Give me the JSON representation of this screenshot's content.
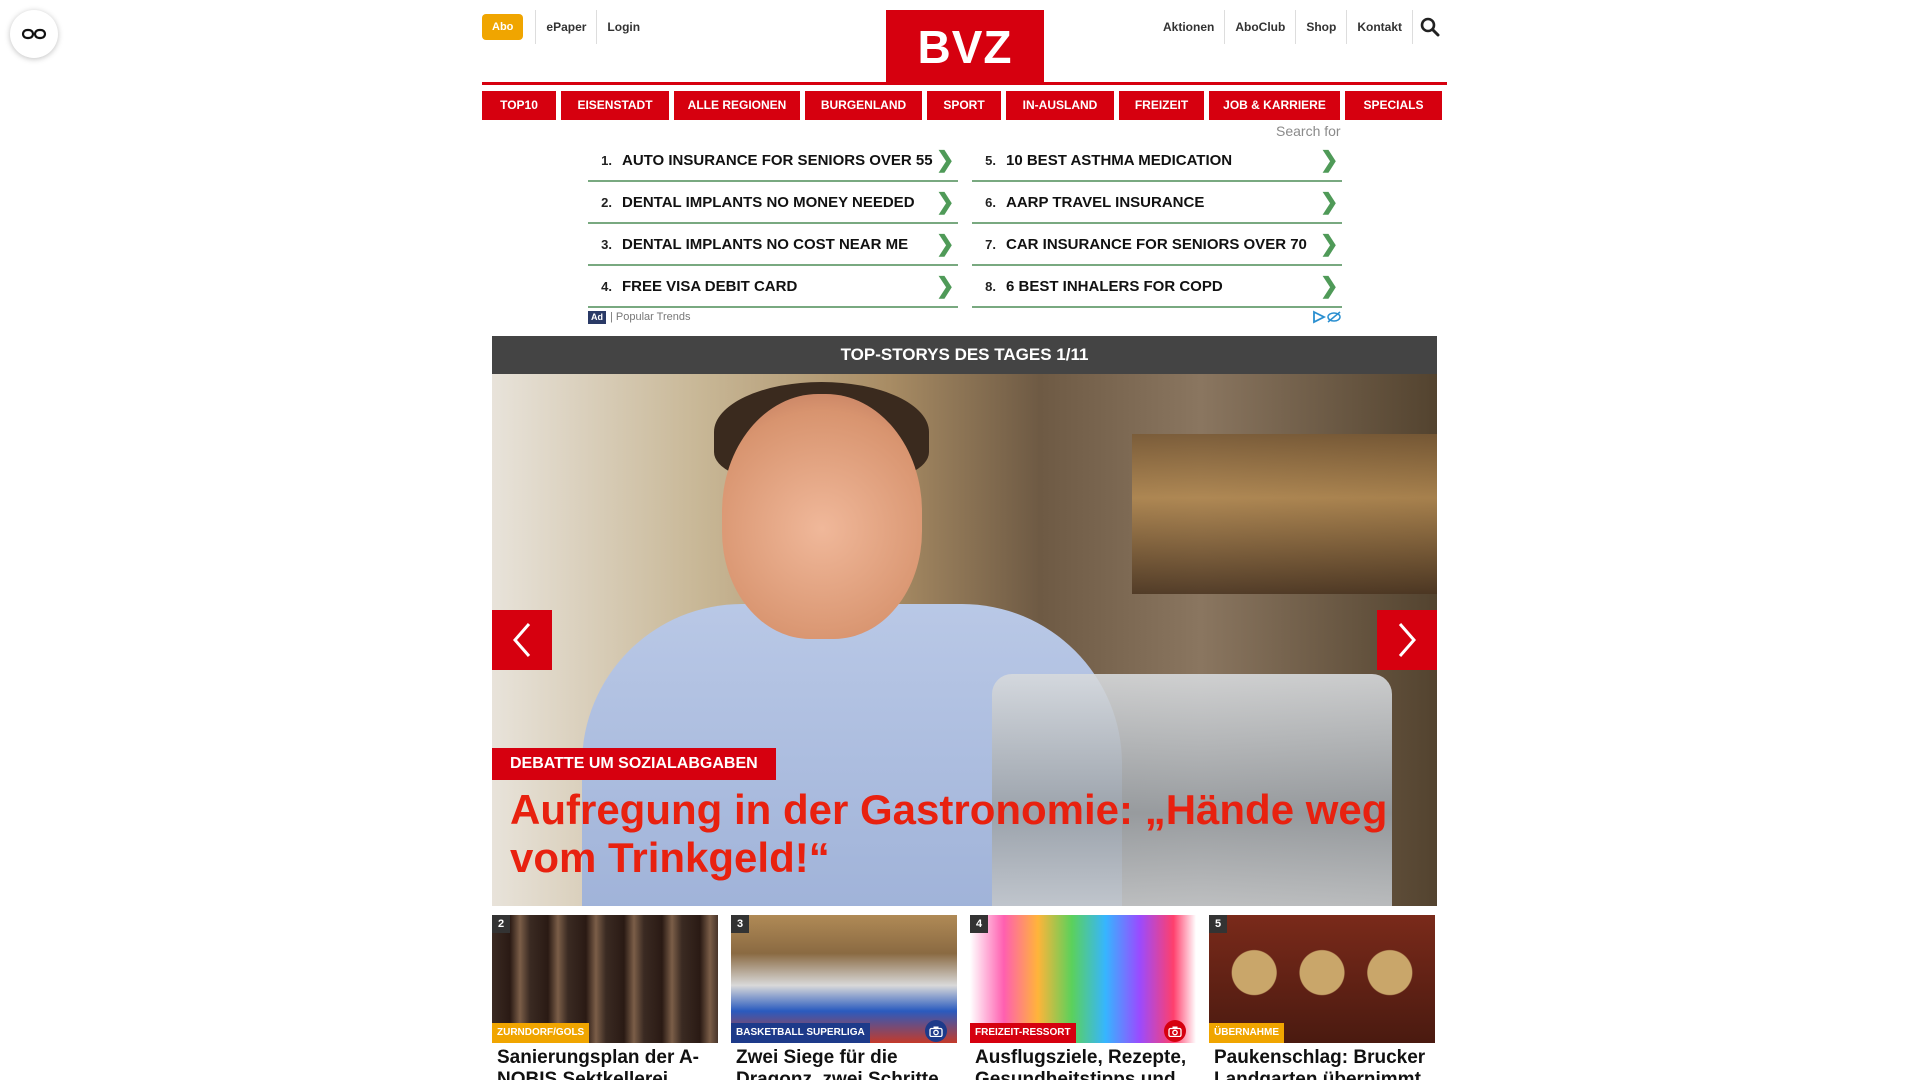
{
  "header": {
    "abo": "Abo",
    "left_links": [
      "ePaper",
      "Login"
    ],
    "logo": "BVZ",
    "right_links": [
      "Aktionen",
      "AboClub",
      "Shop",
      "Kontakt"
    ]
  },
  "nav": {
    "items": [
      "TOP10",
      "EISENSTADT",
      "ALLE REGIONEN",
      "BURGENLAND",
      "SPORT",
      "IN-AUSLAND",
      "FREIZEIT",
      "JOB & KARRIERE",
      "SPECIALS"
    ]
  },
  "ad": {
    "search_for": "Search for",
    "left": [
      {
        "num": "1.",
        "label": "AUTO INSURANCE FOR SENIORS OVER 55"
      },
      {
        "num": "2.",
        "label": "DENTAL IMPLANTS NO MONEY NEEDED"
      },
      {
        "num": "3.",
        "label": "DENTAL IMPLANTS NO COST NEAR ME"
      },
      {
        "num": "4.",
        "label": "FREE VISA DEBIT CARD"
      }
    ],
    "right": [
      {
        "num": "5.",
        "label": "10 BEST ASTHMA MEDICATION"
      },
      {
        "num": "6.",
        "label": "AARP TRAVEL INSURANCE"
      },
      {
        "num": "7.",
        "label": "CAR INSURANCE FOR SENIORS OVER 70"
      },
      {
        "num": "8.",
        "label": "6 BEST INHALERS FOR COPD"
      }
    ],
    "chevron": "❯",
    "badge": "Ad",
    "footer": "| Popular Trends"
  },
  "hero": {
    "bar_title": "TOP-STORYS DES TAGES 1/11",
    "kicker": "DEBATTE UM SOZIALABGABEN",
    "title": "Aufregung in der Gastronomie: „Hände weg vom Trinkgeld!“"
  },
  "cards": [
    {
      "num": "2",
      "tag": "ZURNDORF/GOLS",
      "tag_color": "#f0a500",
      "title": "Sanierungsplan der A-NOBIS Sektkellerei",
      "camera": false
    },
    {
      "num": "3",
      "tag": "BASKETBALL SUPERLIGA",
      "tag_color": "#1d3a8a",
      "title": "Zwei Siege für die Dragonz, zwei Schritte",
      "camera": true,
      "camera_color": "#1d3a8a"
    },
    {
      "num": "4",
      "tag": "FREIZEIT-RESSORT",
      "tag_color": "#d6000f",
      "title": "Ausflugsziele, Rezepte, Gesundheitstipps und",
      "camera": true,
      "camera_color": "#d6000f"
    },
    {
      "num": "5",
      "tag": "ÜBERNAHME",
      "tag_color": "#f0a500",
      "title": "Paukenschlag: Brucker Landgarten übernimmt",
      "camera": false
    }
  ],
  "colors": {
    "brand_red": "#d6000f",
    "accent_yellow": "#f0a500",
    "ad_green": "#79a980"
  }
}
